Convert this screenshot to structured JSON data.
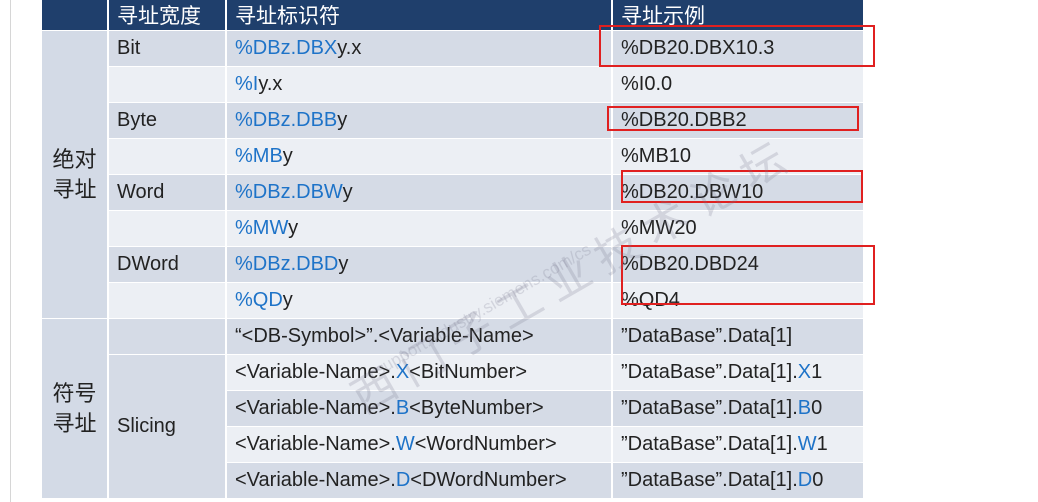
{
  "header": {
    "col1": "寻址宽度",
    "col2": "寻址标识符",
    "col3": "寻址示例"
  },
  "groups": {
    "absolute": "绝对\n寻址",
    "symbolic": "符号\n寻址"
  },
  "widths": {
    "bit": "Bit",
    "byte": "Byte",
    "word": "Word",
    "dword": "DWord",
    "slicing": "Slicing"
  },
  "rows": [
    {
      "id_prefix": "%DBz.DBX",
      "id_rest": "y.x",
      "example": "%DB20.DBX10.3"
    },
    {
      "id_prefix": "%I",
      "id_rest": "y.x",
      "example": "%I0.0"
    },
    {
      "id_prefix": "%DBz.DBB",
      "id_rest": "y",
      "example": "%DB20.DBB2"
    },
    {
      "id_prefix": "%MB",
      "id_rest": "y",
      "example": "%MB10"
    },
    {
      "id_prefix": "%DBz.DBW",
      "id_rest": "y",
      "example": "%DB20.DBW10"
    },
    {
      "id_prefix": "%MW",
      "id_rest": "y",
      "example": "%MW20"
    },
    {
      "id_prefix": "%DBz.DBD",
      "id_rest": "y",
      "example": "%DB20.DBD24"
    },
    {
      "id_prefix": "%QD",
      "id_rest": "y",
      "example": "%QD4"
    }
  ],
  "symbolic_rows": [
    {
      "identifier": "“<DB-Symbol>”.<Variable-Name>",
      "example": "”DataBase”.Data[1]"
    },
    {
      "id_a": "<Variable-Name>.",
      "id_b": "X",
      "id_c": "<BitNumber>",
      "ex_a": "”DataBase”.Data[1].",
      "ex_b": "X",
      "ex_c": "1"
    },
    {
      "id_a": "<Variable-Name>.",
      "id_b": "B",
      "id_c": "<ByteNumber>",
      "ex_a": "”DataBase”.Data[1].",
      "ex_b": "B",
      "ex_c": "0"
    },
    {
      "id_a": "<Variable-Name>.",
      "id_b": "W",
      "id_c": "<WordNumber>",
      "ex_a": "”DataBase”.Data[1].",
      "ex_b": "W",
      "ex_c": "1"
    },
    {
      "id_a": "<Variable-Name>.",
      "id_b": "D",
      "id_c": "<DWordNumber>",
      "ex_a": "”DataBase”.Data[1].",
      "ex_b": "D",
      "ex_c": "0"
    }
  ],
  "watermark": {
    "line1": "西门子工业技术论坛",
    "line2": "support.industry.siemens.com/cs"
  },
  "colors": {
    "header_bg": "#1f3f6c",
    "row_dark": "#d5dbe6",
    "row_light": "#eceff4",
    "accent_blue": "#1e73c8",
    "highlight_red": "#e02020"
  }
}
